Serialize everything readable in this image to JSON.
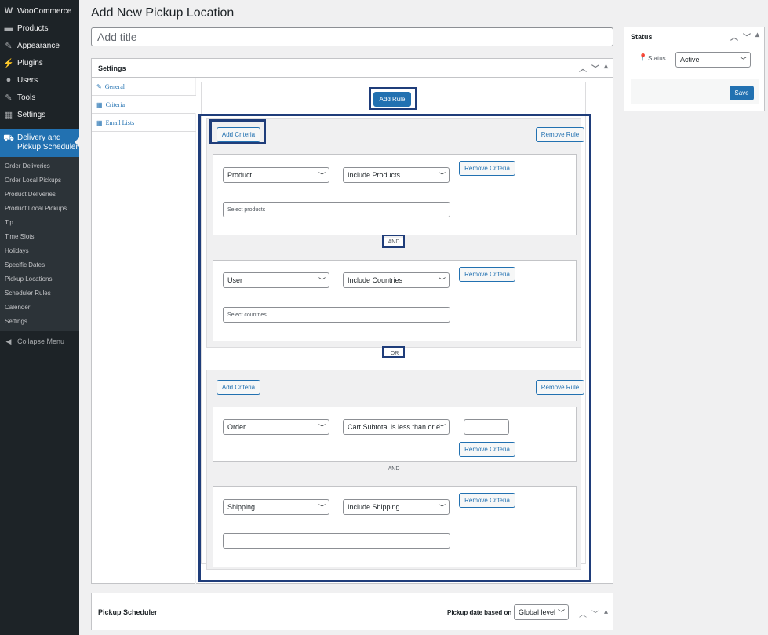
{
  "sidebar": {
    "top_items": [
      {
        "label": "WooCommerce",
        "icon": "woocommerce-icon",
        "glyph": "W"
      },
      {
        "label": "Products",
        "icon": "products-icon",
        "glyph": "▬"
      },
      {
        "label": "Appearance",
        "icon": "appearance-icon",
        "glyph": "✎"
      },
      {
        "label": "Plugins",
        "icon": "plugins-icon",
        "glyph": "⚡"
      },
      {
        "label": "Users",
        "icon": "users-icon",
        "glyph": "●"
      },
      {
        "label": "Tools",
        "icon": "tools-icon",
        "glyph": "✎"
      },
      {
        "label": "Settings",
        "icon": "settings-icon",
        "glyph": "▦"
      }
    ],
    "active_item": {
      "label_line1": "Delivery and",
      "label_line2": "Pickup Scheduler",
      "icon": "delivery-scheduler-icon"
    },
    "submenu": [
      "Order Deliveries",
      "Order Local Pickups",
      "Product Deliveries",
      "Product Local Pickups",
      "Tip",
      "Time Slots",
      "Holidays",
      "Specific Dates",
      "Pickup Locations",
      "Scheduler Rules",
      "Calender",
      "Settings"
    ],
    "collapse_label": "Collapse Menu"
  },
  "header": {
    "title": "Add New Pickup Location",
    "title_placeholder": "Add title"
  },
  "settings": {
    "heading": "Settings",
    "tabs": [
      {
        "label": "General",
        "icon": "wrench-icon",
        "glyph": "🔧"
      },
      {
        "label": "Criteria",
        "icon": "table-icon",
        "glyph": "▦"
      },
      {
        "label": "Email Lists",
        "icon": "table-icon",
        "glyph": "▦"
      }
    ],
    "add_rule": "Add Rule",
    "add_criteria": "Add Criteria",
    "remove_rule": "Remove Rule",
    "remove_criteria": "Remove Criteria",
    "and": "AND",
    "or": "OR",
    "rule1": {
      "c1": {
        "type": "Product",
        "condition": "Include Products",
        "placeholder": "Select products"
      },
      "c2": {
        "type": "User",
        "condition": "Include Countries",
        "placeholder": "Select countries"
      }
    },
    "rule2": {
      "c1": {
        "type": "Order",
        "condition": "Cart Subtotal is less than or e"
      },
      "c2": {
        "type": "Shipping",
        "condition": "Include Shipping"
      }
    }
  },
  "status": {
    "heading": "Status",
    "label": "Status",
    "value": "Active",
    "save": "Save"
  },
  "pickup": {
    "heading": "Pickup Scheduler",
    "date_label": "Pickup date based on",
    "date_value": "Global level"
  },
  "colors": {
    "accent": "#2271b1",
    "highlight": "#1f3d7a",
    "sidebar": "#1d2327"
  }
}
